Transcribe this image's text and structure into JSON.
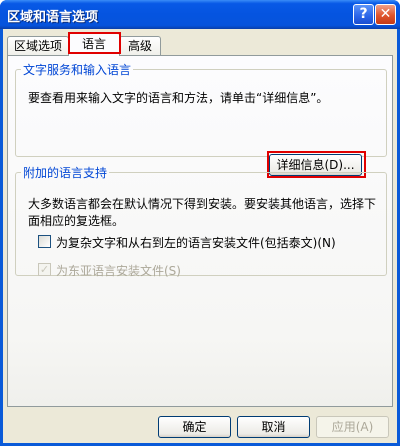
{
  "window": {
    "title": "区域和语言选项",
    "help_glyph": "?",
    "close_glyph": "✕"
  },
  "tabs": [
    {
      "label": "区域选项"
    },
    {
      "label": "语言"
    },
    {
      "label": "高级"
    }
  ],
  "text_services": {
    "legend": "文字服务和输入语言",
    "description": "要查看用来输入文字的语言和方法，请单击“详细信息”。",
    "details_button": "详细信息(D)..."
  },
  "supplemental": {
    "legend": "附加的语言支持",
    "description": "大多数语言都会在默认情况下得到安装。要安装其他语言，选择下面相应的复选框。",
    "complex_script_label": "为复杂文字和从右到左的语言安装文件(包括泰文)(N)",
    "complex_script_checked": false,
    "east_asian_label": "为东亚语言安装文件(S)",
    "east_asian_checked": true,
    "east_asian_check_glyph": "✓"
  },
  "buttons": {
    "ok": "确定",
    "cancel": "取消",
    "apply": "应用(A)"
  },
  "colors": {
    "title_bar": "#0554e0",
    "legend_text": "#0046d5",
    "highlight": "#e00000"
  }
}
